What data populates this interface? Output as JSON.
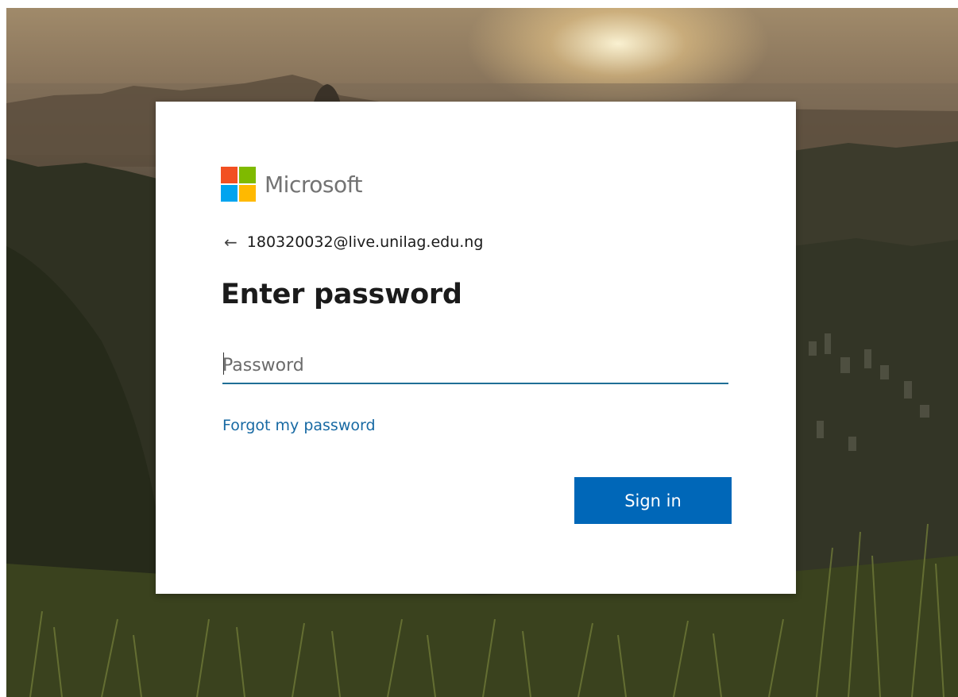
{
  "brand": {
    "name": "Microsoft",
    "logo_colors": [
      "#f25022",
      "#7fba00",
      "#00a4ef",
      "#ffb900"
    ]
  },
  "identity": {
    "back_icon": "←",
    "account": "180320032@live.unilag.edu.ng"
  },
  "heading": "Enter password",
  "password_field": {
    "placeholder": "Password",
    "value": ""
  },
  "forgot_link": "Forgot my password",
  "signin_button": "Sign in",
  "colors": {
    "accent_button": "#0067b8",
    "link": "#1769a3",
    "input_underline": "#1f6f96"
  },
  "icons": [
    "back-arrow-icon",
    "microsoft-logo-icon"
  ]
}
